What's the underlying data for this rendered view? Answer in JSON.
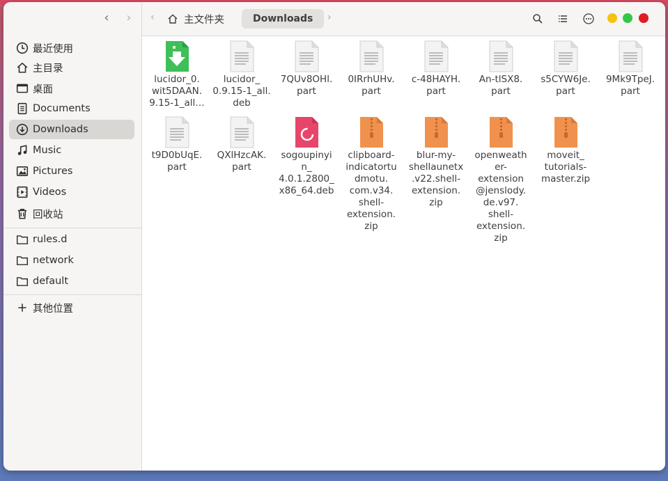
{
  "sidebar": {
    "items": [
      {
        "label": "最近使用",
        "icon": "clock-icon"
      },
      {
        "label": "主目录",
        "icon": "home-icon"
      },
      {
        "label": "桌面",
        "icon": "desktop-icon"
      },
      {
        "label": "Documents",
        "icon": "document-icon"
      },
      {
        "label": "Downloads",
        "icon": "download-icon",
        "active": true
      },
      {
        "label": "Music",
        "icon": "music-icon"
      },
      {
        "label": "Pictures",
        "icon": "pictures-icon"
      },
      {
        "label": "Videos",
        "icon": "videos-icon"
      },
      {
        "label": "回收站",
        "icon": "trash-icon"
      },
      {
        "label": "rules.d",
        "icon": "folder-icon"
      },
      {
        "label": "network",
        "icon": "folder-icon"
      },
      {
        "label": "default",
        "icon": "folder-icon"
      },
      {
        "label": "其他位置",
        "icon": "plus-icon"
      }
    ]
  },
  "path": {
    "home_label": "主文件夹",
    "current_label": "Downloads"
  },
  "window_controls": {
    "minimize_color": "#f5c211",
    "maximize_color": "#33c748",
    "close_color": "#e01b24"
  },
  "files": [
    {
      "name": "lucidor_0.\nwit5DAAN.\n9.15-1_all…",
      "type": "download"
    },
    {
      "name": "lucidor_\n0.9.15-1_all.\ndeb",
      "type": "text"
    },
    {
      "name": "7QUv8OHl.\npart",
      "type": "text"
    },
    {
      "name": "0IRrhUHv.\npart",
      "type": "text"
    },
    {
      "name": "c-48HAYH.\npart",
      "type": "text"
    },
    {
      "name": "An-tlSX8.\npart",
      "type": "text"
    },
    {
      "name": "s5CYW6Je.\npart",
      "type": "text"
    },
    {
      "name": "9Mk9TpeJ.\npart",
      "type": "text"
    },
    {
      "name": "t9D0bUqE.\npart",
      "type": "text"
    },
    {
      "name": "QXlHzcAK.\npart",
      "type": "text"
    },
    {
      "name": "sogoupinyi\nn_\n4.0.1.2800_\nx86_64.deb",
      "type": "debian"
    },
    {
      "name": "clipboard-\nindicatortu\ndmotu.\ncom.v34.\nshell-\nextension.\nzip",
      "type": "zip"
    },
    {
      "name": "blur-my-\nshellaunetx\n.v22.shell-\nextension.\nzip",
      "type": "zip"
    },
    {
      "name": "openweath\ner-\nextension\n@jenslody.\nde.v97.\nshell-\nextension.\nzip",
      "type": "zip"
    },
    {
      "name": "moveit_\ntutorials-\nmaster.zip",
      "type": "zip"
    }
  ]
}
